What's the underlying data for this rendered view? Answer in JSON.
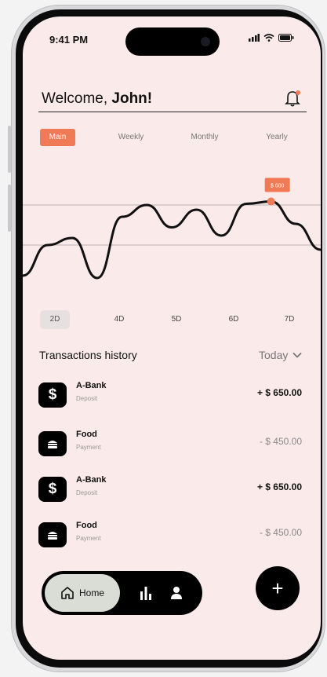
{
  "status_bar": {
    "time": "9:41 PM"
  },
  "header": {
    "greeting": "Welcome, ",
    "user_name": "John!"
  },
  "period_tabs": [
    "Main",
    "Weekly",
    "Monthly",
    "Yearly"
  ],
  "active_period": "Main",
  "chart_data": {
    "type": "line",
    "highlight_label": "$ 600",
    "values": [
      0.12,
      0.38,
      0.44,
      0.1,
      0.62,
      0.72,
      0.53,
      0.68,
      0.46,
      0.73,
      0.75,
      0.56,
      0.34
    ]
  },
  "day_tabs": [
    "2D",
    "4D",
    "5D",
    "6D",
    "7D"
  ],
  "active_day": "2D",
  "transactions": {
    "title": "Transactions history",
    "filter": "Today",
    "items": [
      {
        "name": "A-Bank",
        "type": "Deposit",
        "amount": "+ $ 650.00",
        "icon": "dollar-icon",
        "positive": true
      },
      {
        "name": "Food",
        "type": "Payment",
        "amount": "- $ 450.00",
        "icon": "burger-icon",
        "positive": false
      },
      {
        "name": "A-Bank",
        "type": "Deposit",
        "amount": "+ $ 650.00",
        "icon": "dollar-icon",
        "positive": true
      },
      {
        "name": "Food",
        "type": "Payment",
        "amount": "- $ 450.00",
        "icon": "burger-icon",
        "positive": false
      }
    ]
  },
  "nav": {
    "home_label": "Home",
    "fab_label": "+"
  },
  "colors": {
    "accent": "#f07a55",
    "background": "#fbeaea",
    "dark": "#000000"
  }
}
